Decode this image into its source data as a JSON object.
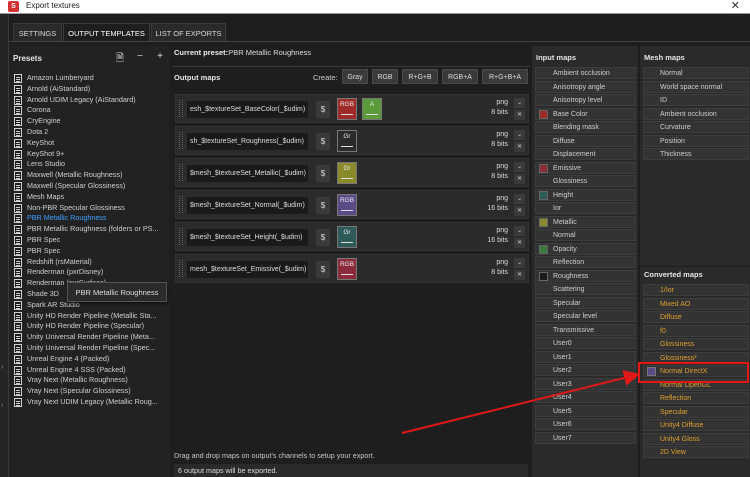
{
  "window": {
    "title": "Export textures",
    "close_glyph": "✕"
  },
  "tabs": [
    {
      "label": "SETTINGS",
      "active": false
    },
    {
      "label": "OUTPUT TEMPLATES",
      "active": true
    },
    {
      "label": "LIST OF EXPORTS",
      "active": false
    }
  ],
  "presets": {
    "header": "Presets",
    "items": [
      "Amazon Lumberyard",
      "Arnold (AiStandard)",
      "Arnold UDIM Legacy (AiStandard)",
      "Corona",
      "CryEngine",
      "Dota 2",
      "KeyShot",
      "KeyShot 9+",
      "Lens Studio",
      "Maxwell (Metallic Roughness)",
      "Maxwell (Specular Glossiness)",
      "Mesh Maps",
      "Non-PBR Specular Glossiness",
      "PBR Metallic Roughness",
      "PBR Metallic Roughness (folders or PS...",
      "PBR Spec",
      "PBR Spec",
      "Redshift (rsMaterial)",
      "Renderman (pxrDisney)",
      "Renderman (pxrSurface)",
      "Shade 3D",
      "Spark AR Studio",
      "Unity HD Render Pipeline (Metallic Sta...",
      "Unity HD Render Pipeline (Specular)",
      "Unity Universal Render Pipeline (Meta...",
      "Unity Universal Render Pipeline (Spec...",
      "Unreal Engine 4 (Packed)",
      "Unreal Engine 4 SSS (Packed)",
      "Vray Next (Metallic Roughness)",
      "Vray Next (Specular Glossiness)",
      "Vray Next UDIM Legacy (Metallic Roug..."
    ],
    "selected_index": 13,
    "tooltip": "PBR Metallic Roughness"
  },
  "current_preset": {
    "label": "Current preset:",
    "value": "PBR Metallic Roughness"
  },
  "output_maps": {
    "title": "Output maps",
    "create_label": "Create:",
    "create_buttons": [
      "Gray",
      "RGB",
      "R+G+B",
      "RGB+A",
      "R+G+B+A"
    ],
    "rows": [
      {
        "name": "esh_$textureSet_BaseColor(_$udim)",
        "format": "png",
        "bits": "8 bits",
        "channels": [
          {
            "label": "RGB",
            "color": "#9e2a2a"
          },
          {
            "label": "A",
            "color": "#5a9a3a"
          }
        ]
      },
      {
        "name": "sh_$textureSet_Roughness(_$udim)",
        "format": "png",
        "bits": "8 bits",
        "channels": [
          {
            "label": "Gr",
            "color": "#2b2b2b"
          }
        ]
      },
      {
        "name": "$mesh_$textureSet_Metallic(_$udim)",
        "format": "png",
        "bits": "8 bits",
        "channels": [
          {
            "label": "Gr",
            "color": "#8a8a2a"
          }
        ]
      },
      {
        "name": "$mesh_$textureSet_Normal(_$udim)",
        "format": "png",
        "bits": "16 bits",
        "channels": [
          {
            "label": "RGB",
            "color": "#5a4a86"
          }
        ]
      },
      {
        "name": "$mesh_$textureSet_Height(_$udim)",
        "format": "png",
        "bits": "16 bits",
        "channels": [
          {
            "label": "Gr",
            "color": "#2e5a5a"
          }
        ]
      },
      {
        "name": "mesh_$textureSet_Emissive(_$udim)",
        "format": "png",
        "bits": "8 bits",
        "channels": [
          {
            "label": "RGB",
            "color": "#8a2a3a"
          }
        ]
      }
    ],
    "drag_hint": "Drag and drop maps on output's channels to setup your export.",
    "status": "6 output maps will be exported."
  },
  "input_maps": {
    "header": "Input maps",
    "items": [
      {
        "label": "Ambient occlusion",
        "color": ""
      },
      {
        "label": "Anisotropy angle",
        "color": ""
      },
      {
        "label": "Anisotropy level",
        "color": ""
      },
      {
        "label": "Base Color",
        "color": "#9e2a2a"
      },
      {
        "label": "Blending mask",
        "color": ""
      },
      {
        "label": "Diffuse",
        "color": ""
      },
      {
        "label": "Displacement",
        "color": ""
      },
      {
        "label": "Emissive",
        "color": "#8a2a3a"
      },
      {
        "label": "Glossiness",
        "color": ""
      },
      {
        "label": "Height",
        "color": "#2e5a5a"
      },
      {
        "label": "Ior",
        "color": ""
      },
      {
        "label": "Metallic",
        "color": "#8a8a2a"
      },
      {
        "label": "Normal",
        "color": ""
      },
      {
        "label": "Opacity",
        "color": "#3a7a3a"
      },
      {
        "label": "Reflection",
        "color": ""
      },
      {
        "label": "Roughness",
        "color": "#1a1a1a"
      },
      {
        "label": "Scattering",
        "color": ""
      },
      {
        "label": "Specular",
        "color": ""
      },
      {
        "label": "Specular level",
        "color": ""
      },
      {
        "label": "Transmissive",
        "color": ""
      },
      {
        "label": "User0",
        "color": ""
      },
      {
        "label": "User1",
        "color": ""
      },
      {
        "label": "User2",
        "color": ""
      },
      {
        "label": "User3",
        "color": ""
      },
      {
        "label": "User4",
        "color": ""
      },
      {
        "label": "User5",
        "color": ""
      },
      {
        "label": "User6",
        "color": ""
      },
      {
        "label": "User7",
        "color": ""
      }
    ]
  },
  "mesh_maps": {
    "header": "Mesh maps",
    "items": [
      "Normal",
      "World space normal",
      "ID",
      "Ambient occlusion",
      "Curvature",
      "Position",
      "Thickness"
    ]
  },
  "converted_maps": {
    "header": "Converted maps",
    "items": [
      {
        "label": "1/Ior",
        "color": ""
      },
      {
        "label": "Mixed AO",
        "color": ""
      },
      {
        "label": "Diffuse",
        "color": ""
      },
      {
        "label": "f0",
        "color": ""
      },
      {
        "label": "Glossiness",
        "color": ""
      },
      {
        "label": "Glossiness²",
        "color": ""
      },
      {
        "label": "Normal DirectX",
        "color": "#5a4a86"
      },
      {
        "label": "Normal OpenGL",
        "color": ""
      },
      {
        "label": "Reflection",
        "color": ""
      },
      {
        "label": "Specular",
        "color": ""
      },
      {
        "label": "Unity4 Diffuse",
        "color": ""
      },
      {
        "label": "Unity4 Gloss",
        "color": ""
      },
      {
        "label": "2D View",
        "color": ""
      }
    ]
  },
  "annotation": {
    "highlight_color": "#e01818"
  }
}
